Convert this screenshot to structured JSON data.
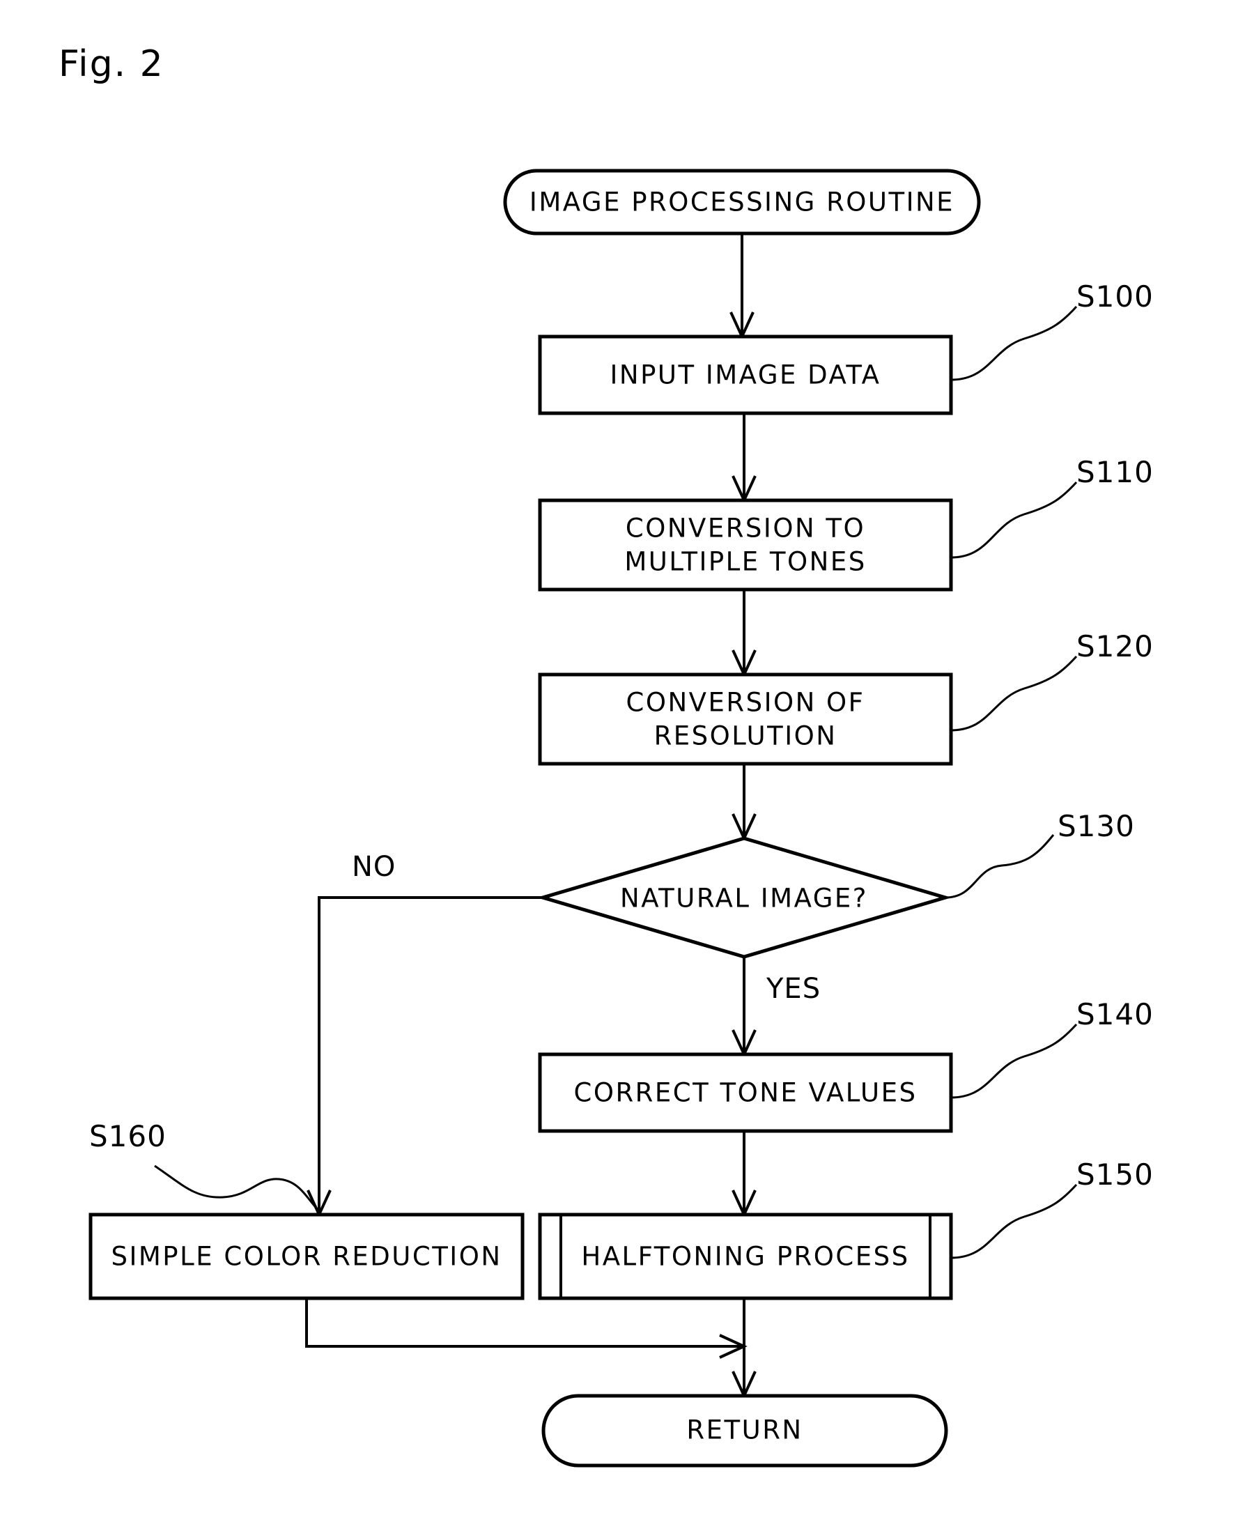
{
  "figure": {
    "label": "Fig. 2",
    "title": "IMAGE PROCESSING ROUTINE flowchart"
  },
  "nodes": {
    "start": {
      "label": "IMAGE PROCESSING ROUTINE",
      "shape": "terminator"
    },
    "s100": {
      "label": "INPUT IMAGE DATA",
      "shape": "process",
      "step": "S100"
    },
    "s110": {
      "line1": "CONVERSION TO",
      "line2": "MULTIPLE TONES",
      "shape": "process",
      "step": "S110"
    },
    "s120": {
      "line1": "CONVERSION OF",
      "line2": "RESOLUTION",
      "shape": "process",
      "step": "S120"
    },
    "s130": {
      "label": "NATURAL IMAGE?",
      "shape": "decision",
      "step": "S130"
    },
    "s140": {
      "label": "CORRECT TONE VALUES",
      "shape": "process",
      "step": "S140"
    },
    "s150": {
      "label": "HALFTONING PROCESS",
      "shape": "predefined-process",
      "step": "S150"
    },
    "s160": {
      "label": "SIMPLE COLOR REDUCTION",
      "shape": "process",
      "step": "S160"
    },
    "end": {
      "label": "RETURN",
      "shape": "terminator"
    }
  },
  "branches": {
    "no": "NO",
    "yes": "YES"
  },
  "colors": {
    "ink": "#000000",
    "paper": "#ffffff"
  }
}
